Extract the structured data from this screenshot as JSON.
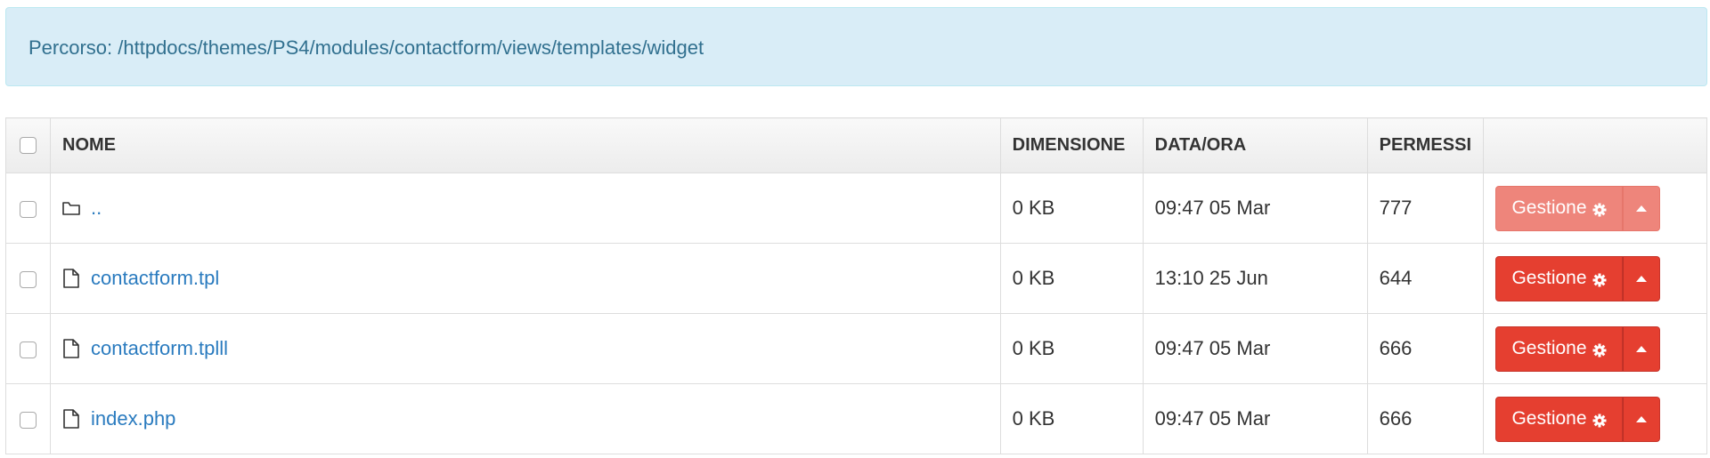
{
  "path_bar": {
    "text": "Percorso: /httpdocs/themes/PS4/modules/contactform/views/templates/widget"
  },
  "table": {
    "headers": {
      "name": "NOME",
      "size": "DIMENSIONE",
      "date": "DATA/ORA",
      "permissions": "PERMESSI"
    },
    "rows": [
      {
        "type": "folder",
        "icon": "folder-icon",
        "name": "..",
        "size": "0 KB",
        "date": "09:47 05 Mar",
        "permissions": "777",
        "action_label": "Gestione",
        "action_disabled": true
      },
      {
        "type": "file",
        "icon": "file-icon",
        "name": "contactform.tpl",
        "size": "0 KB",
        "date": "13:10 25 Jun",
        "permissions": "644",
        "action_label": "Gestione",
        "action_disabled": false
      },
      {
        "type": "file",
        "icon": "file-icon",
        "name": "contactform.tplll",
        "size": "0 KB",
        "date": "09:47 05 Mar",
        "permissions": "666",
        "action_label": "Gestione",
        "action_disabled": false
      },
      {
        "type": "file",
        "icon": "file-icon",
        "name": "index.php",
        "size": "0 KB",
        "date": "09:47 05 Mar",
        "permissions": "666",
        "action_label": "Gestione",
        "action_disabled": false
      }
    ]
  },
  "colors": {
    "info_bg": "#d9edf7",
    "info_text": "#31708f",
    "link": "#2a7bbf",
    "danger": "#e53f30",
    "danger_disabled": "#ee857b"
  }
}
